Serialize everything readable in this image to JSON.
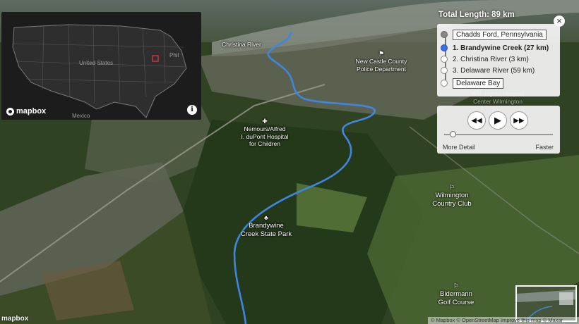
{
  "map": {
    "place_labels": [
      {
        "text": "Christina River",
        "icon": ""
      },
      {
        "text": "New Castle County\nPolice Department",
        "icon": "police-icon"
      },
      {
        "text": "Nemours/Alfred\nI. duPont Hospital\nfor Children",
        "icon": "hospital-icon"
      },
      {
        "text": "Brandywine\nCreek State Park",
        "icon": "park-icon"
      },
      {
        "text": "Wilmington\nCountry Club",
        "icon": "golf-icon"
      },
      {
        "text": "Bidermann\nGolf Course",
        "icon": "golf-icon"
      },
      {
        "text": "Wilmington Hospital\nCenter Wilmington",
        "icon": ""
      }
    ],
    "route_color": "#3f86e0"
  },
  "inset": {
    "country_label": "United States",
    "mexico_label": "Mexico",
    "city_label": "Phil",
    "logo": "mapbox",
    "info_icon": "info-icon"
  },
  "route": {
    "total_length": "Total Length: 89 km",
    "close_icon": "close-icon",
    "origin": "Chadds Ford, Pennsylvania",
    "segments": [
      {
        "label": "1. Brandywine Creek (27 km)",
        "active": true
      },
      {
        "label": "2. Christina River (3 km)",
        "active": false
      },
      {
        "label": "3. Delaware River (59 km)",
        "active": false
      }
    ],
    "destination": "Delaware Bay"
  },
  "playback": {
    "rewind_icon": "rewind-icon",
    "play_icon": "play-icon",
    "forward_icon": "fast-forward-icon",
    "speed_level": 0.08,
    "left_label": "More Detail",
    "right_label": "Faster"
  },
  "footer": {
    "logo": "mapbox",
    "attribution": "© Mapbox © OpenStreetMap Improve this map © Maxar"
  }
}
